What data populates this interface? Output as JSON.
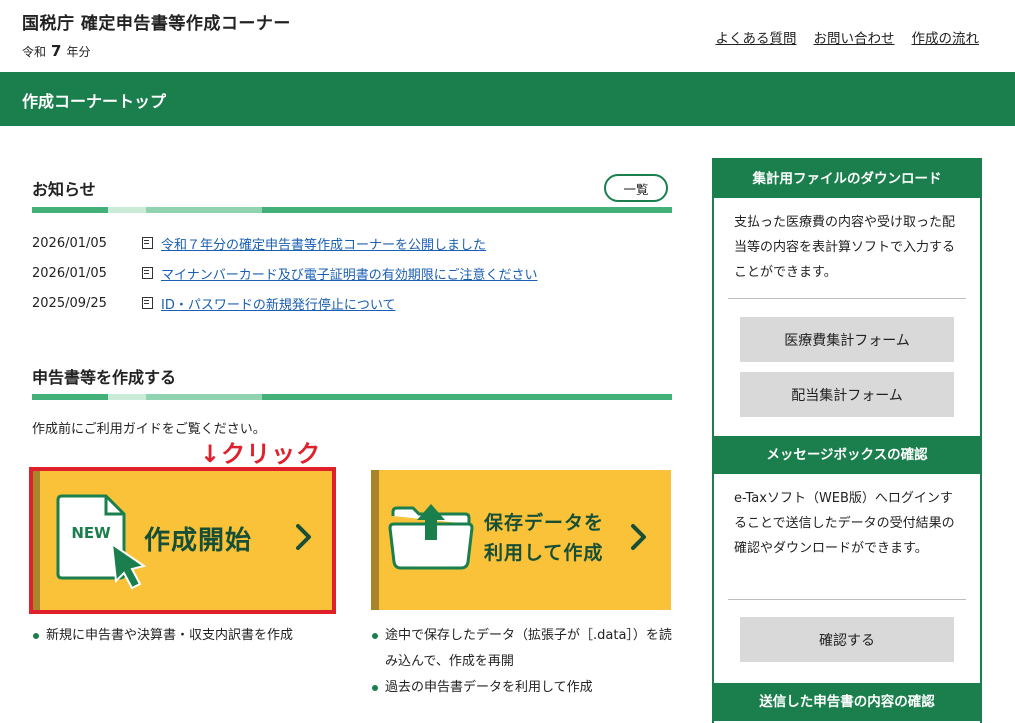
{
  "header": {
    "site_title": "国税庁 確定申告書等作成コーナー",
    "year_prefix": "令和",
    "year_num": "7",
    "year_suffix": "年分",
    "links": [
      "よくある質問",
      "お問い合わせ",
      "作成の流れ"
    ]
  },
  "page_bar": {
    "title": "作成コーナートップ"
  },
  "news": {
    "title": "お知らせ",
    "list_all_label": "一覧",
    "items": [
      {
        "date": "2026/01/05",
        "text": "令和７年分の確定申告書等作成コーナーを公開しました"
      },
      {
        "date": "2026/01/05",
        "text": "マイナンバーカード及び電子証明書の有効期限にご注意ください"
      },
      {
        "date": "2025/09/25",
        "text": "ID・パスワードの新規発行停止について"
      }
    ]
  },
  "create": {
    "title": "申告書等を作成する",
    "guide_text": "作成前にご利用ガイドをご覧ください。",
    "annotation": "↓クリック",
    "start_card": {
      "badge": "NEW",
      "label": "作成開始",
      "bullets": [
        "新規に申告書や決算書・収支内訳書を作成"
      ]
    },
    "save_card": {
      "label_line1": "保存データを",
      "label_line2": "利用して作成",
      "bullets": [
        "途中で保存したデータ（拡張子が［.data］）を読み込んで、作成を再開",
        "過去の申告書データを利用して作成"
      ]
    }
  },
  "sidebar": {
    "aggregate": {
      "title": "集計用ファイルのダウンロード",
      "text": "支払った医療費の内容や受け取った配当等の内容を表計算ソフトで入力することができます。",
      "buttons": [
        "医療費集計フォーム",
        "配当集計フォーム"
      ]
    },
    "messagebox": {
      "title": "メッセージボックスの確認",
      "text": "e-Taxソフト（WEB版）へログインすることで送信したデータの受付結果の確認やダウンロードができます。",
      "button": "確認する"
    },
    "sent": {
      "title": "送信した申告書の内容の確認"
    }
  },
  "colors": {
    "brand_green": "#1b7f4d",
    "card_yellow": "#f9c238",
    "highlight_red": "#e0202a",
    "link_blue": "#1a5fb4"
  }
}
